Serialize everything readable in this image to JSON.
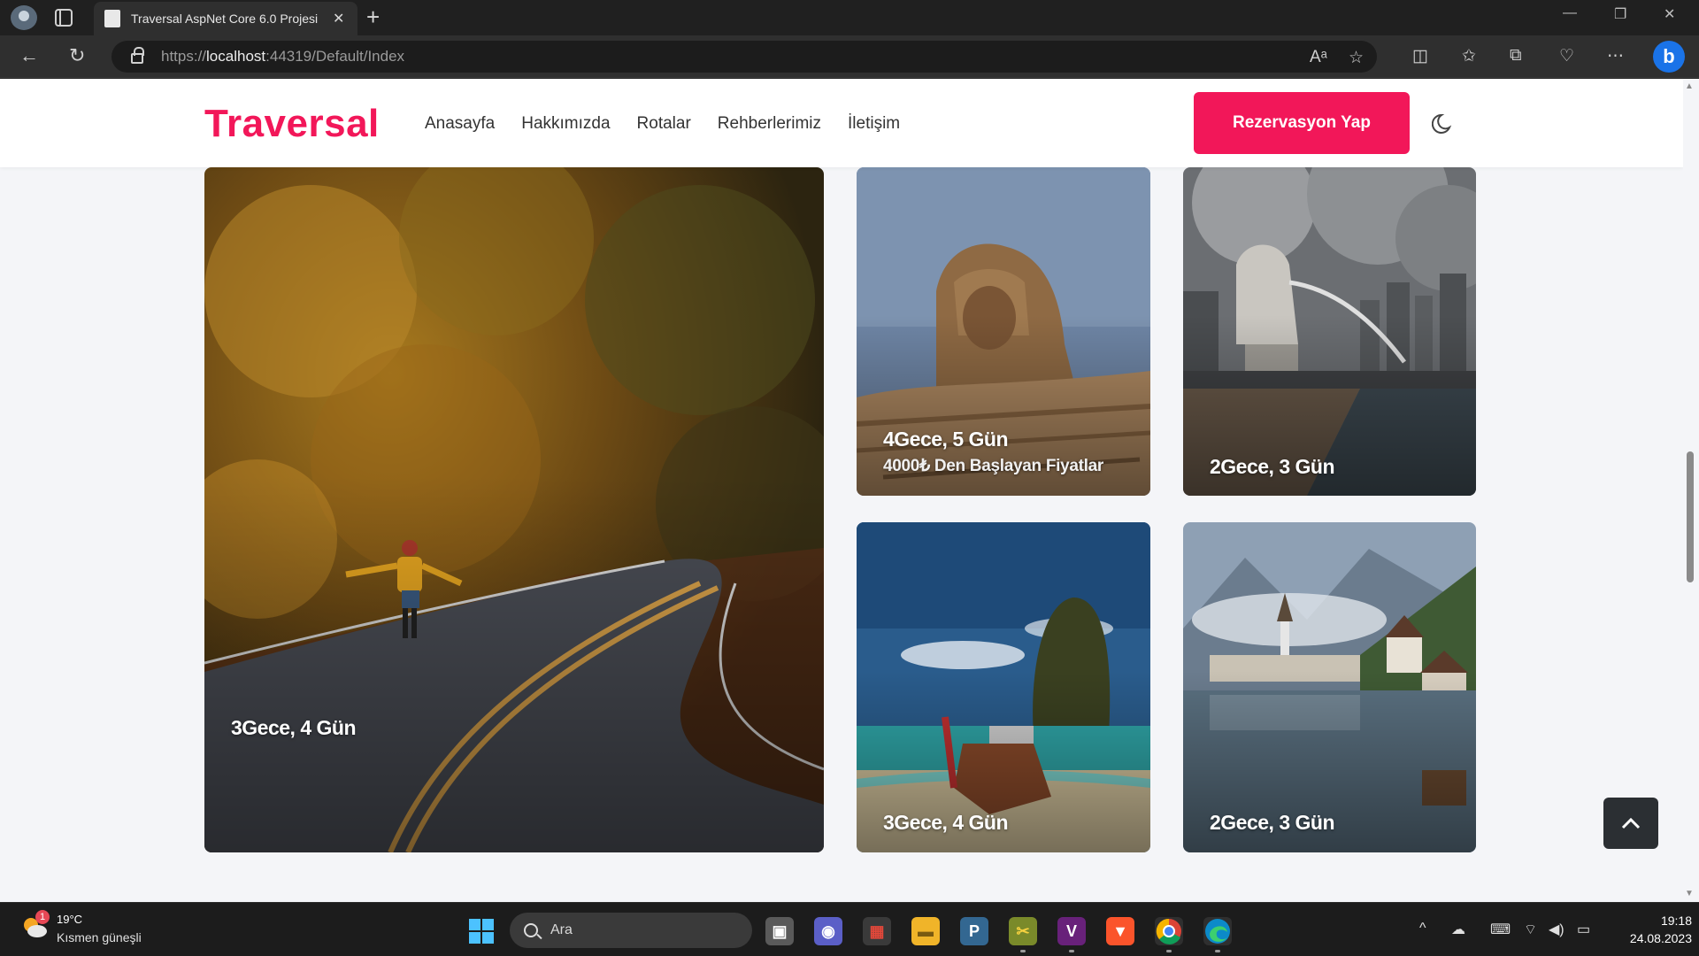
{
  "browser": {
    "tab_title": "Traversal AspNet Core 6.0 Projesi",
    "url_prefix": "https://",
    "url_host": "localhost",
    "url_rest": ":44319/Default/Index"
  },
  "site": {
    "logo": "Traversal",
    "nav": [
      "Anasayfa",
      "Hakkımızda",
      "Rotalar",
      "Rehberlerimiz",
      "İletişim"
    ],
    "cta_label": "Rezervasyon Yap"
  },
  "gallery": {
    "cards": [
      {
        "title": "3Gece, 4 Gün",
        "subtitle": ""
      },
      {
        "title": "4Gece, 5 Gün",
        "subtitle": "4000₺ Den Başlayan Fiyatlar"
      },
      {
        "title": "2Gece, 3 Gün",
        "subtitle": ""
      },
      {
        "title": "3Gece, 4 Gün",
        "subtitle": ""
      },
      {
        "title": "2Gece, 3 Gün",
        "subtitle": ""
      }
    ]
  },
  "taskbar": {
    "weather_badge": "1",
    "weather_temp": "19°C",
    "weather_desc": "Kısmen güneşli",
    "search_placeholder": "Ara",
    "time": "19:18",
    "date": "24.08.2023"
  },
  "colors": {
    "brand": "#f21759",
    "page_bg": "#f4f5f8"
  }
}
